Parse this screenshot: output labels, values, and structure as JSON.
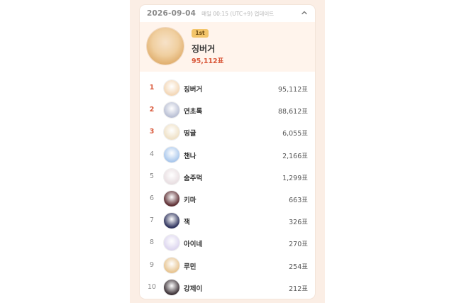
{
  "header": {
    "date": "2026-09-04",
    "update_text": "매일 00:15 (UTC+9) 업데이트"
  },
  "top": {
    "badge": "1st",
    "name": "징버거",
    "votes": "95,112표"
  },
  "ranking": [
    {
      "rank": "1",
      "name": "징버거",
      "votes": "95,112표",
      "avatar_color": "#f3d7b6"
    },
    {
      "rank": "2",
      "name": "연초록",
      "votes": "88,612표",
      "avatar_color": "#b9bfd4"
    },
    {
      "rank": "3",
      "name": "띵귤",
      "votes": "6,055표",
      "avatar_color": "#efe1c6"
    },
    {
      "rank": "4",
      "name": "챈나",
      "votes": "2,166표",
      "avatar_color": "#a9c7ec"
    },
    {
      "rank": "5",
      "name": "숨주먹",
      "votes": "1,299표",
      "avatar_color": "#e9dfe2"
    },
    {
      "rank": "6",
      "name": "키마",
      "votes": "663표",
      "avatar_color": "#5a2a2f"
    },
    {
      "rank": "7",
      "name": "잭",
      "votes": "326표",
      "avatar_color": "#2a2f5a"
    },
    {
      "rank": "8",
      "name": "아이네",
      "votes": "270표",
      "avatar_color": "#ddd6ef"
    },
    {
      "rank": "9",
      "name": "루민",
      "votes": "254표",
      "avatar_color": "#e7c490"
    },
    {
      "rank": "10",
      "name": "강제이",
      "votes": "212표",
      "avatar_color": "#3b3035"
    }
  ],
  "colors": {
    "accent": "#d9583a",
    "badge": "#f3c56a",
    "panel": "#fbeee5"
  },
  "icons": {
    "collapse": "chevron-up-icon"
  }
}
